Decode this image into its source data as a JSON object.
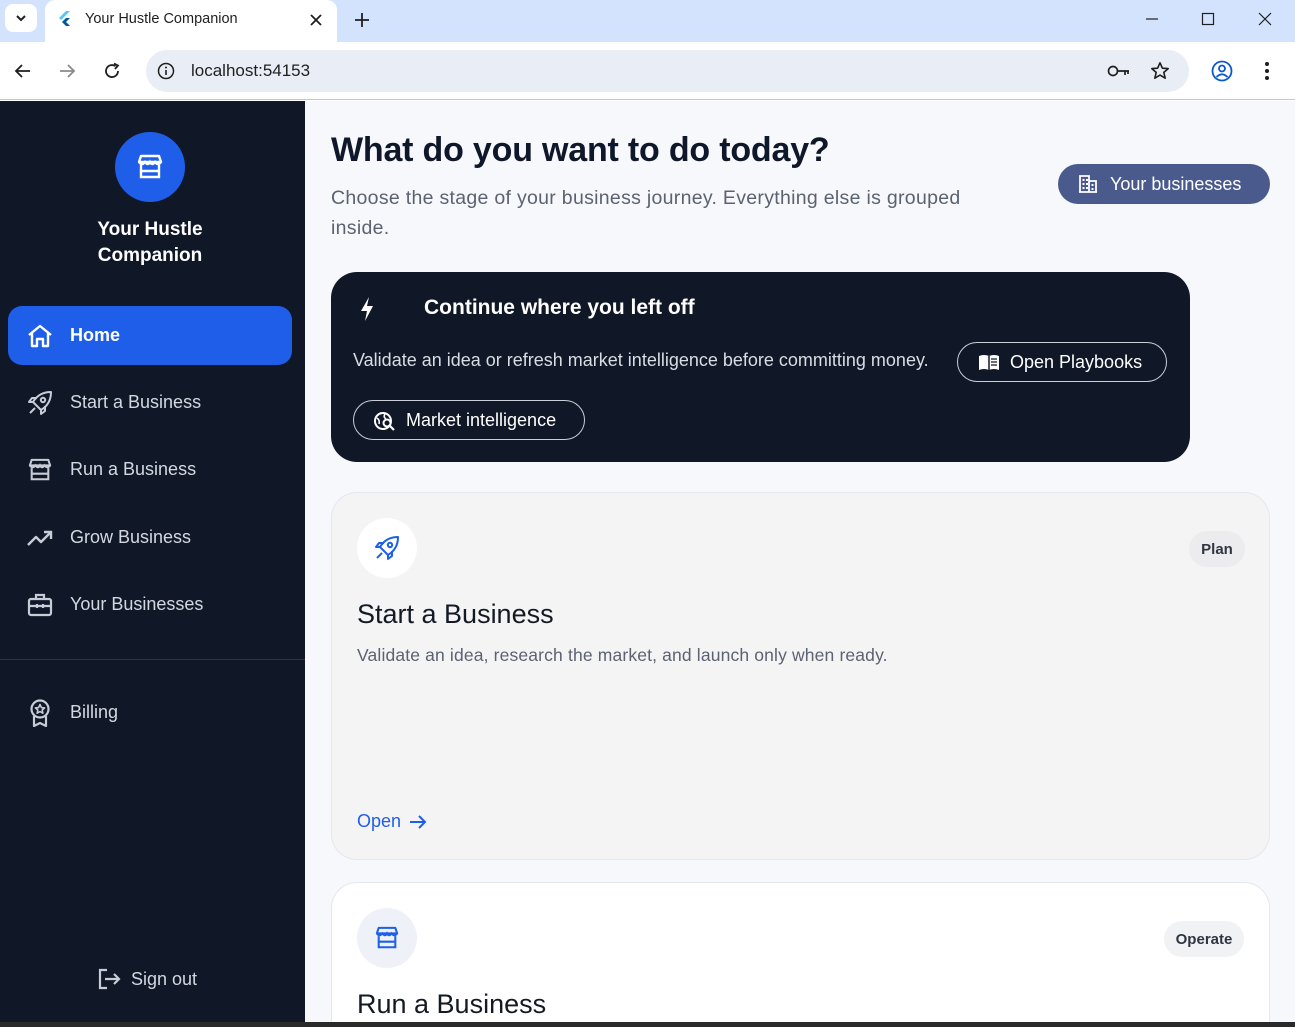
{
  "browser": {
    "tab_title": "Your Hustle Companion",
    "url": "localhost:54153"
  },
  "sidebar": {
    "brand": "Your Hustle Companion",
    "items": [
      {
        "label": "Home",
        "icon": "home-icon",
        "active": true
      },
      {
        "label": "Start a Business",
        "icon": "rocket-icon"
      },
      {
        "label": "Run a Business",
        "icon": "storefront-icon"
      },
      {
        "label": "Grow Business",
        "icon": "trending-up-icon"
      },
      {
        "label": "Your Businesses",
        "icon": "briefcase-icon"
      },
      {
        "label": "Billing",
        "icon": "award-icon"
      }
    ],
    "signout": "Sign out"
  },
  "header": {
    "title": "What do you want to do today?",
    "subtitle": "Choose the stage of your business journey. Everything else is grouped inside.",
    "businesses_button": "Your businesses"
  },
  "continue_card": {
    "title": "Continue where you left off",
    "description": "Validate an idea or refresh market intelligence before committing money.",
    "playbooks_button": "Open Playbooks",
    "market_button": "Market intelligence"
  },
  "cards": [
    {
      "title": "Start a Business",
      "description": "Validate an idea, research the market, and launch only when ready.",
      "tag": "Plan",
      "cta": "Open",
      "icon": "rocket-icon"
    },
    {
      "title": "Run a Business",
      "tag": "Operate",
      "icon": "storefront-icon"
    }
  ],
  "colors": {
    "accent": "#1f5ee8",
    "sidebar_bg": "#101828",
    "businesses_button": "#4b5a8c"
  }
}
